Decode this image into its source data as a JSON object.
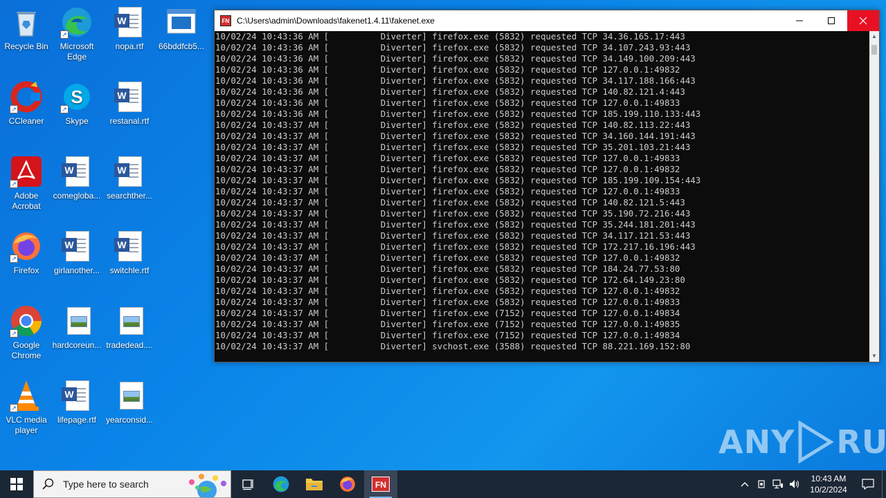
{
  "desktop": {
    "icons": [
      {
        "label": "Recycle Bin"
      },
      {
        "label": "Microsoft Edge"
      },
      {
        "label": "nopa.rtf"
      },
      {
        "label": "66bddfcb5..."
      },
      {
        "label": "CCleaner"
      },
      {
        "label": "Skype"
      },
      {
        "label": "restanal.rtf"
      },
      {
        "label": "Adobe Acrobat"
      },
      {
        "label": "comegloba..."
      },
      {
        "label": "searchther..."
      },
      {
        "label": "Firefox"
      },
      {
        "label": "girlanother..."
      },
      {
        "label": "switchle.rtf"
      },
      {
        "label": "Google Chrome"
      },
      {
        "label": "hardcoreun..."
      },
      {
        "label": "tradedead...."
      },
      {
        "label": "VLC media player"
      },
      {
        "label": "lifepage.rtf"
      },
      {
        "label": "yearconsid..."
      }
    ]
  },
  "console": {
    "app_icon_text": "FN",
    "title": "C:\\Users\\admin\\Downloads\\fakenet1.4.11\\fakenet.exe",
    "lines": [
      "10/02/24 10:43:36 AM [          Diverter] firefox.exe (5832) requested TCP 34.36.165.17:443",
      "10/02/24 10:43:36 AM [          Diverter] firefox.exe (5832) requested TCP 34.107.243.93:443",
      "10/02/24 10:43:36 AM [          Diverter] firefox.exe (5832) requested TCP 34.149.100.209:443",
      "10/02/24 10:43:36 AM [          Diverter] firefox.exe (5832) requested TCP 127.0.0.1:49832",
      "10/02/24 10:43:36 AM [          Diverter] firefox.exe (5832) requested TCP 34.117.188.166:443",
      "10/02/24 10:43:36 AM [          Diverter] firefox.exe (5832) requested TCP 140.82.121.4:443",
      "10/02/24 10:43:36 AM [          Diverter] firefox.exe (5832) requested TCP 127.0.0.1:49833",
      "10/02/24 10:43:36 AM [          Diverter] firefox.exe (5832) requested TCP 185.199.110.133:443",
      "10/02/24 10:43:37 AM [          Diverter] firefox.exe (5832) requested TCP 140.82.113.22:443",
      "10/02/24 10:43:37 AM [          Diverter] firefox.exe (5832) requested TCP 34.160.144.191:443",
      "10/02/24 10:43:37 AM [          Diverter] firefox.exe (5832) requested TCP 35.201.103.21:443",
      "10/02/24 10:43:37 AM [          Diverter] firefox.exe (5832) requested TCP 127.0.0.1:49833",
      "10/02/24 10:43:37 AM [          Diverter] firefox.exe (5832) requested TCP 127.0.0.1:49832",
      "10/02/24 10:43:37 AM [          Diverter] firefox.exe (5832) requested TCP 185.199.109.154:443",
      "10/02/24 10:43:37 AM [          Diverter] firefox.exe (5832) requested TCP 127.0.0.1:49833",
      "10/02/24 10:43:37 AM [          Diverter] firefox.exe (5832) requested TCP 140.82.121.5:443",
      "10/02/24 10:43:37 AM [          Diverter] firefox.exe (5832) requested TCP 35.190.72.216:443",
      "10/02/24 10:43:37 AM [          Diverter] firefox.exe (5832) requested TCP 35.244.181.201:443",
      "10/02/24 10:43:37 AM [          Diverter] firefox.exe (5832) requested TCP 34.117.121.53:443",
      "10/02/24 10:43:37 AM [          Diverter] firefox.exe (5832) requested TCP 172.217.16.196:443",
      "10/02/24 10:43:37 AM [          Diverter] firefox.exe (5832) requested TCP 127.0.0.1:49832",
      "10/02/24 10:43:37 AM [          Diverter] firefox.exe (5832) requested TCP 184.24.77.53:80",
      "10/02/24 10:43:37 AM [          Diverter] firefox.exe (5832) requested TCP 172.64.149.23:80",
      "10/02/24 10:43:37 AM [          Diverter] firefox.exe (5832) requested TCP 127.0.0.1:49832",
      "10/02/24 10:43:37 AM [          Diverter] firefox.exe (5832) requested TCP 127.0.0.1:49833",
      "10/02/24 10:43:37 AM [          Diverter] firefox.exe (7152) requested TCP 127.0.0.1:49834",
      "10/02/24 10:43:37 AM [          Diverter] firefox.exe (7152) requested TCP 127.0.0.1:49835",
      "10/02/24 10:43:37 AM [          Diverter] firefox.exe (7152) requested TCP 127.0.0.1:49834",
      "10/02/24 10:43:37 AM [          Diverter] svchost.exe (3588) requested TCP 88.221.169.152:80"
    ]
  },
  "watermark": {
    "text_left": "ANY",
    "text_right": "RUN"
  },
  "taskbar": {
    "search_placeholder": "Type here to search",
    "clock_time": "10:43 AM",
    "clock_date": "10/2/2024",
    "active_app_label": "FN"
  }
}
